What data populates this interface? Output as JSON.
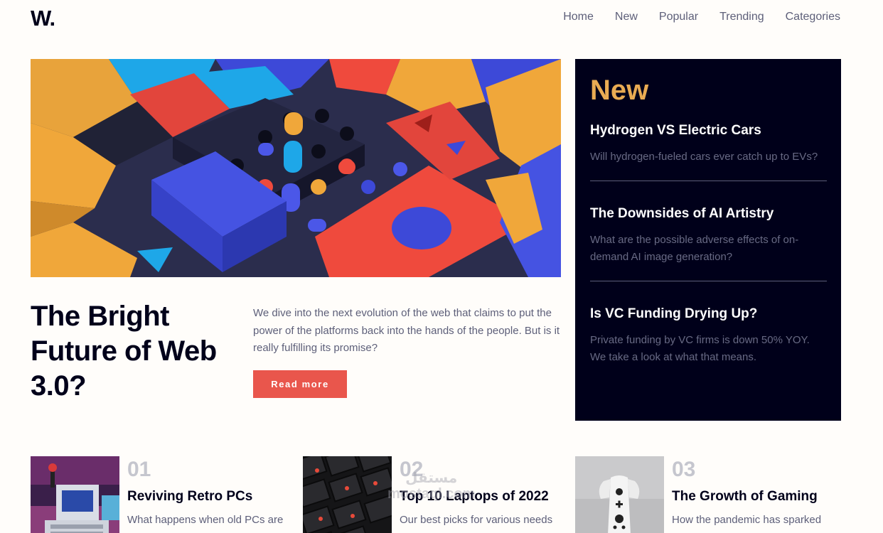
{
  "header": {
    "logo": "W.",
    "nav": [
      "Home",
      "New",
      "Popular",
      "Trending",
      "Categories"
    ]
  },
  "hero": {
    "title": "The Bright Future of Web 3.0?",
    "description": "We dive into the next evolution of the web that claims to put the power of the platforms back into the hands of the people. But is it really fulfilling its promise?",
    "button_label": "Read more"
  },
  "new_panel": {
    "heading": "New",
    "items": [
      {
        "title": "Hydrogen VS Electric Cars",
        "description": "Will hydrogen-fueled cars ever catch up to EVs?"
      },
      {
        "title": "The Downsides of AI Artistry",
        "description": "What are the possible adverse effects of on-demand AI image generation?"
      },
      {
        "title": "Is VC Funding Drying Up?",
        "description": "Private funding by VC firms is down 50% YOY. We take a look at what that means."
      }
    ]
  },
  "trending": [
    {
      "number": "01",
      "title": "Reviving Retro PCs",
      "description": "What happens when old PCs are"
    },
    {
      "number": "02",
      "title": "Top 10 Laptops of 2022",
      "description": "Our best picks for various needs"
    },
    {
      "number": "03",
      "title": "The Growth of Gaming",
      "description": "How the pandemic has sparked"
    }
  ],
  "watermark": {
    "line1": "مستقل",
    "line2": "mostaql.com"
  },
  "colors": {
    "accent_red": "#e9564c",
    "accent_orange": "#e9ab53",
    "dark_navy": "#00001a",
    "text_grey": "#5d5f79"
  }
}
